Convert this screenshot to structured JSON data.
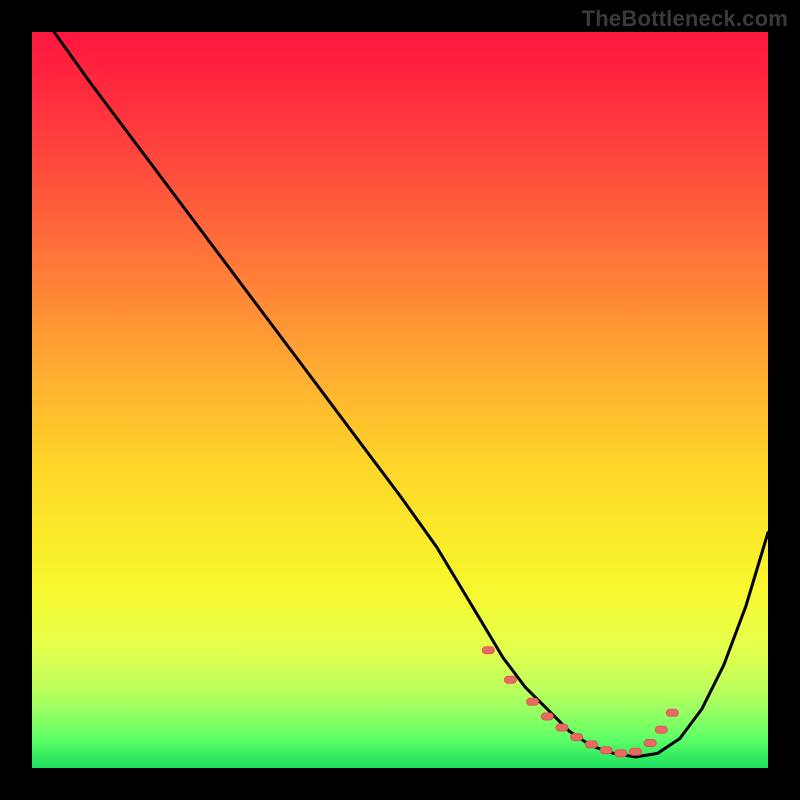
{
  "watermark": "TheBottleneck.com",
  "colors": {
    "background": "#000000",
    "curve_stroke": "#000000",
    "marker_fill": "#e86a62",
    "marker_stroke": "#d85a52",
    "gradient_top": "#ff173f",
    "gradient_bottom": "#1bde5d"
  },
  "chart_data": {
    "type": "line",
    "title": "",
    "xlabel": "",
    "ylabel": "",
    "xlim": [
      0,
      100
    ],
    "ylim": [
      0,
      100
    ],
    "note": "No axis ticks or numeric labels are visible in the source image; x/y are normalized percent of plot width/height with y=0 at bottom.",
    "series": [
      {
        "name": "bottleneck-curve",
        "x": [
          3,
          8,
          14,
          20,
          26,
          32,
          38,
          44,
          50,
          55,
          58,
          61,
          64,
          67,
          70,
          73,
          76,
          79,
          82,
          85,
          88,
          91,
          94,
          97,
          100
        ],
        "y": [
          100,
          93,
          85,
          77,
          69,
          61,
          53,
          45,
          37,
          30,
          25,
          20,
          15,
          11,
          8,
          5,
          3,
          2,
          1.5,
          2,
          4,
          8,
          14,
          22,
          32
        ]
      }
    ],
    "markers": {
      "name": "highlight-points",
      "x": [
        62,
        65,
        68,
        70,
        72,
        74,
        76,
        78,
        80,
        82,
        84,
        85.5,
        87
      ],
      "y": [
        16,
        12,
        9,
        7,
        5.5,
        4.2,
        3.2,
        2.4,
        2,
        2.2,
        3.4,
        5.2,
        7.5
      ]
    }
  }
}
